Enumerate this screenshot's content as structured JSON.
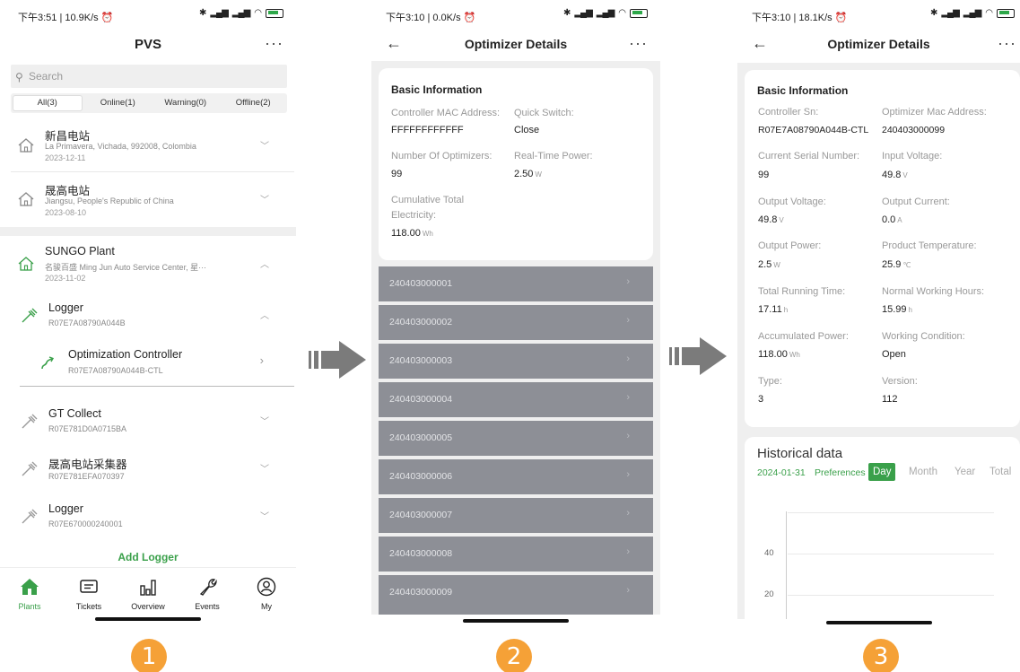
{
  "status": {
    "p1": "下午3:51 | 10.9K/s ⏰",
    "p2": "下午3:10 | 0.0K/s ⏰",
    "p3": "下午3:10 | 18.1K/s ⏰"
  },
  "p1": {
    "title": "PVS",
    "more": "···",
    "search_placeholder": "Search",
    "filters": [
      "All(3)",
      "Online(1)",
      "Warning(0)",
      "Offline(2)"
    ],
    "plants": [
      {
        "name": "新昌电站",
        "address": "La Primavera, Vichada, 992008, Colombia",
        "date": "2023-12-11"
      },
      {
        "name": "晟高电站",
        "address": "Jiangsu, People's Republic of China",
        "date": "2023-08-10"
      },
      {
        "name": "SUNGO Plant",
        "address": "名骏百盛 Ming Jun Auto Service Center, 星···",
        "date": "2023-11-02"
      }
    ],
    "loggers": [
      {
        "name": "Logger",
        "sn": "R07E7A08790A044B"
      },
      {
        "name": "GT Collect",
        "sn": "R07E781D0A0715BA"
      },
      {
        "name": "晟高电站采集器",
        "sn": "R07E781EFA070397"
      },
      {
        "name": "Logger",
        "sn": "R07E670000240001"
      }
    ],
    "controller": {
      "name": "Optimization Controller",
      "sn": "R07E7A08790A044B-CTL"
    },
    "add_logger": "Add Logger",
    "tabs": [
      "Plants",
      "Tickets",
      "Overview",
      "Events",
      "My"
    ]
  },
  "p2": {
    "title": "Optimizer Details",
    "more": "···",
    "card_title": "Basic Information",
    "fields": [
      {
        "label": "Controller MAC Address:",
        "value": "FFFFFFFFFFFF",
        "unit": ""
      },
      {
        "label": "Quick Switch:",
        "value": "Close",
        "unit": ""
      },
      {
        "label": "Number Of Optimizers:",
        "value": "99",
        "unit": ""
      },
      {
        "label": "Real-Time Power:",
        "value": "2.50",
        "unit": "W"
      },
      {
        "label": "Cumulative Total",
        "label2": "Electricity:",
        "value": "118.00",
        "unit": "Wh"
      }
    ],
    "optimizers": [
      "240403000001",
      "240403000002",
      "240403000003",
      "240403000004",
      "240403000005",
      "240403000006",
      "240403000007",
      "240403000008",
      "240403000009"
    ]
  },
  "p3": {
    "title": "Optimizer Details",
    "more": "···",
    "card_title": "Basic Information",
    "fields": [
      {
        "label": "Controller Sn:",
        "value": "R07E7A08790A044B-CTL",
        "unit": ""
      },
      {
        "label": "Optimizer Mac Address:",
        "value": "240403000099",
        "unit": ""
      },
      {
        "label": "Current Serial Number:",
        "value": "99",
        "unit": ""
      },
      {
        "label": "Input Voltage:",
        "value": "49.8",
        "unit": "V"
      },
      {
        "label": "Output Voltage:",
        "value": "49.8",
        "unit": "V"
      },
      {
        "label": "Output Current:",
        "value": "0.0",
        "unit": "A"
      },
      {
        "label": "Output Power:",
        "value": "2.5",
        "unit": "W"
      },
      {
        "label": "Product Temperature:",
        "value": "25.9",
        "unit": "℃"
      },
      {
        "label": "Total Running Time:",
        "value": "17.11",
        "unit": "h"
      },
      {
        "label": "Normal Working Hours:",
        "value": "15.99",
        "unit": "h"
      },
      {
        "label": "Accumulated Power:",
        "value": "118.00",
        "unit": "Wh"
      },
      {
        "label": "Working Condition:",
        "value": "Open",
        "unit": ""
      },
      {
        "label": "Type:",
        "value": "3",
        "unit": ""
      },
      {
        "label": "Version:",
        "value": "112",
        "unit": ""
      }
    ],
    "history": {
      "title": "Historical data",
      "date": "2024-01-31",
      "preferences": "Preferences",
      "periods": [
        "Day",
        "Month",
        "Year",
        "Total"
      ],
      "active_period": "Day",
      "yticks": [
        "40",
        "20"
      ]
    }
  },
  "steps": [
    "1",
    "2",
    "3"
  ],
  "colors": {
    "accent": "#3aa04a",
    "step": "#f5a137",
    "row": "#8d8f96"
  }
}
